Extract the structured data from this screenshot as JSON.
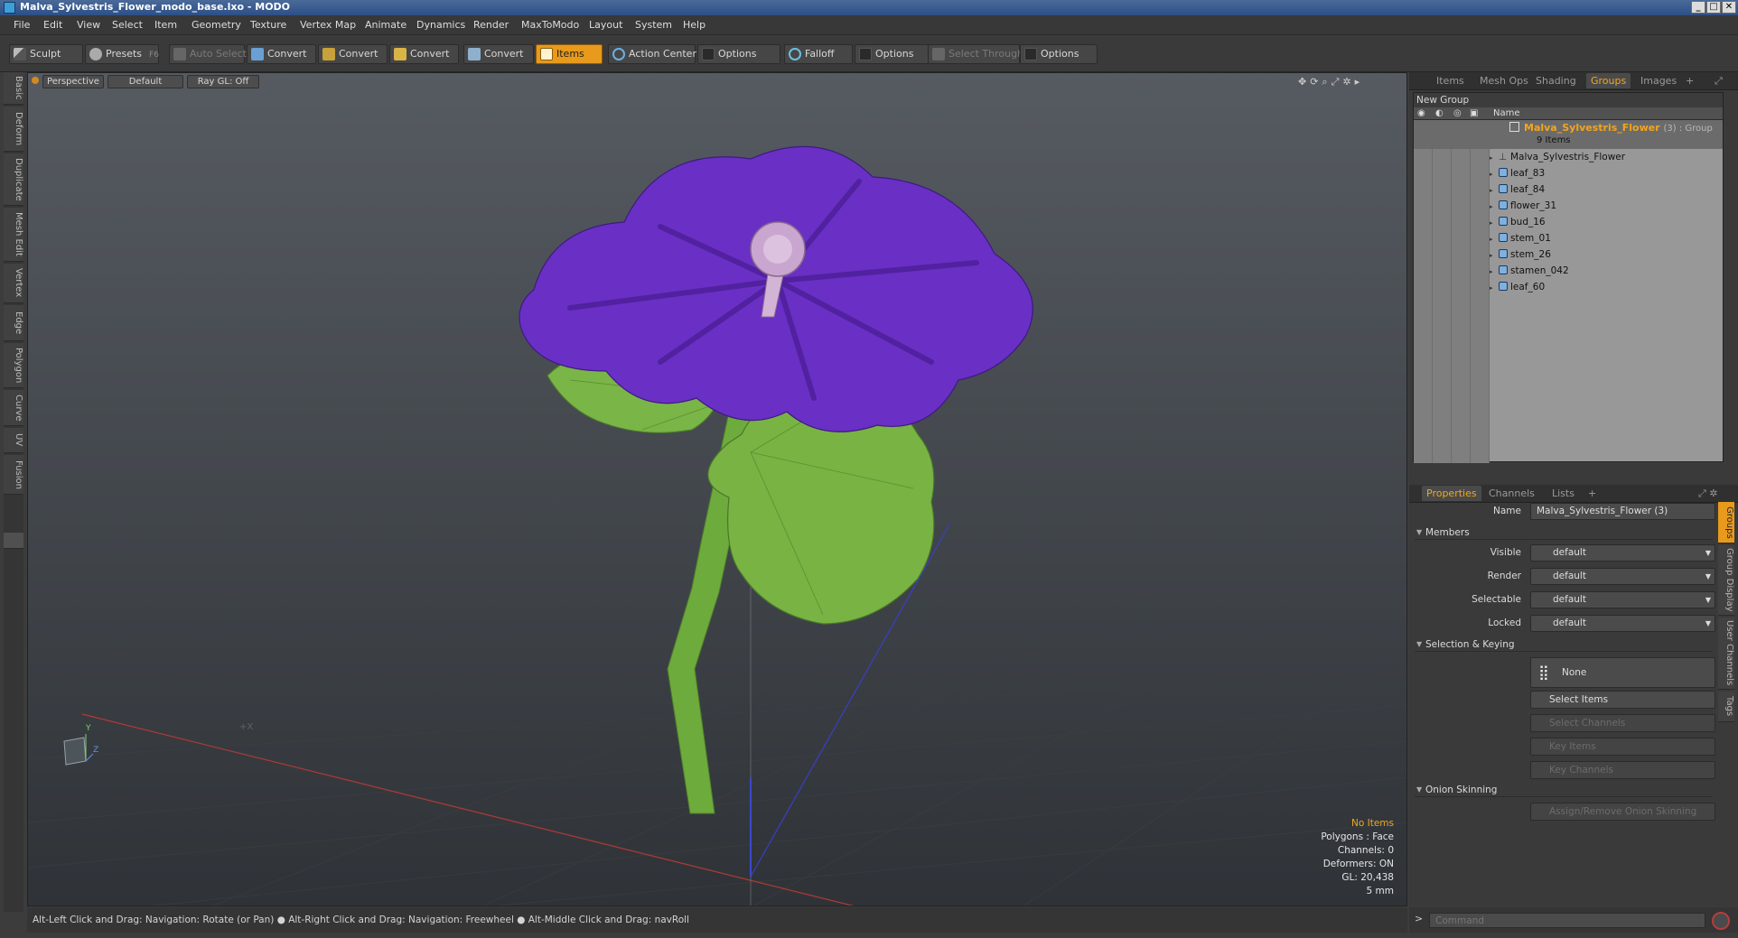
{
  "window": {
    "title": "Malva_Sylvestris_Flower_modo_base.lxo - MODO",
    "buttons": [
      "_",
      "□",
      "✕"
    ]
  },
  "menu": [
    "File",
    "Edit",
    "View",
    "Select",
    "Item",
    "Geometry",
    "Texture",
    "Vertex Map",
    "Animate",
    "Dynamics",
    "Render",
    "MaxToModo",
    "Layout",
    "System",
    "Help"
  ],
  "toolbar": {
    "sculpt": "Sculpt",
    "presets": "Presets",
    "presets_key": "F6",
    "auto_select": "Auto Select",
    "convert_labels": [
      "Convert",
      "Convert",
      "Convert",
      "Convert"
    ],
    "items": "Items",
    "action_center": "Action Center",
    "options1": "Options",
    "falloff": "Falloff",
    "options2": "Options",
    "select_through": "Select Through",
    "options3": "Options"
  },
  "left_tabs": [
    "Basic",
    "Deform",
    "Duplicate",
    "Mesh Edit",
    "Vertex",
    "Edge",
    "Polygon",
    "Curve",
    "UV",
    "Fusion"
  ],
  "viewport": {
    "view": "Perspective",
    "shading": "Default",
    "raygl": "Ray GL: Off",
    "info": {
      "selection": "No Items",
      "polygons": "Polygons : Face",
      "channels": "Channels: 0",
      "deformers": "Deformers: ON",
      "gl": "GL: 20,438",
      "scale": "5 mm"
    },
    "axis_labels": {
      "y": "Y",
      "z": "Z"
    }
  },
  "top_panel": {
    "tabs": [
      "Items",
      "Mesh Ops",
      "Shading",
      "Groups",
      "Images"
    ],
    "active_tab": "Groups",
    "new_group": "New Group",
    "name_header": "Name",
    "group": {
      "name": "Malva_Sylvestris_Flower",
      "suffix": "(3) : Group",
      "count": "9 Items"
    },
    "items": [
      "Malva_Sylvestris_Flower",
      "leaf_83",
      "leaf_84",
      "flower_31",
      "bud_16",
      "stem_01",
      "stem_26",
      "stamen_042",
      "leaf_60"
    ]
  },
  "bottom_panel": {
    "tabs": [
      "Properties",
      "Channels",
      "Lists"
    ],
    "active_tab": "Properties",
    "name_label": "Name",
    "name_value": "Malva_Sylvestris_Flower (3)",
    "members_section": "Members",
    "fields": [
      {
        "label": "Visible",
        "value": "default"
      },
      {
        "label": "Render",
        "value": "default"
      },
      {
        "label": "Selectable",
        "value": "default"
      },
      {
        "label": "Locked",
        "value": "default"
      }
    ],
    "selection_section": "Selection & Keying",
    "none_button": "None",
    "select_items": "Select Items",
    "select_channels": "Select Channels",
    "key_items": "Key Items",
    "key_channels": "Key Channels",
    "onion_section": "Onion Skinning",
    "onion_button": "Assign/Remove Onion Skinning",
    "side_tabs": [
      "Groups",
      "Group Display",
      "User Channels",
      "Tags"
    ]
  },
  "statusbar": "Alt-Left Click and Drag: Navigation: Rotate (or Pan) ● Alt-Right Click and Drag: Navigation: Freewheel ● Alt-Middle Click and Drag: navRoll",
  "command": {
    "prompt": ">",
    "placeholder": "Command"
  },
  "colors": {
    "accent": "#e89a1c",
    "petal": "#6a2fc4",
    "leaf": "#6fb33d"
  }
}
